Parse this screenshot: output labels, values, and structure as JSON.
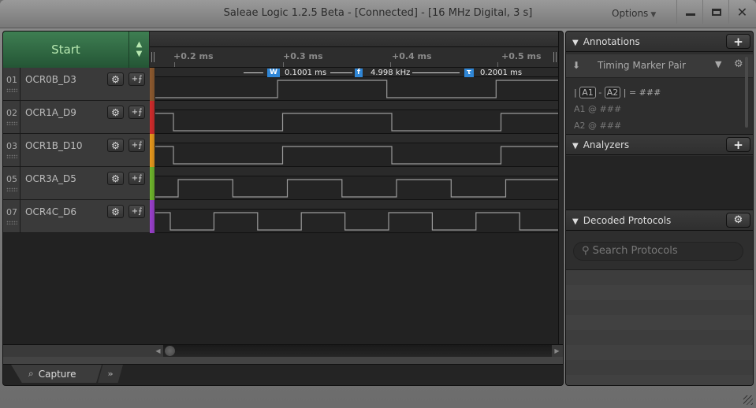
{
  "window": {
    "title": "Saleae Logic 1.2.5 Beta - [Connected] - [16 MHz Digital, 3 s]",
    "options_label": "Options",
    "controls": [
      "minimize",
      "maximize",
      "close"
    ]
  },
  "capture": {
    "start_label": "Start",
    "up_glyph": "▲",
    "down_glyph": "▼"
  },
  "ruler": {
    "ticks": [
      "+0.2 ms",
      "+0.3 ms",
      "+0.4 ms",
      "+0.5 ms"
    ]
  },
  "measurement": {
    "width_badge": "W",
    "width_value": "0.1001 ms",
    "freq_badge": "f",
    "freq_value": "4.998 kHz",
    "period_badge": "τ",
    "period_value": "0.2001 ms"
  },
  "channels": [
    {
      "num": "01",
      "name": "OCR0B_D3",
      "color": "#8f5a2e",
      "period_ms": 0.2001,
      "duty": 0.5
    },
    {
      "num": "02",
      "name": "OCR1A_D9",
      "color": "#d42a2a",
      "period_ms": 0.2,
      "duty": 0.5
    },
    {
      "num": "03",
      "name": "OCR1B_D10",
      "color": "#eb9a1a",
      "period_ms": 0.2,
      "duty": 0.5
    },
    {
      "num": "05",
      "name": "OCR3A_D5",
      "color": "#6fb82a",
      "period_ms": 0.1,
      "duty": 0.5
    },
    {
      "num": "07",
      "name": "OCR4C_D6",
      "color": "#9c3fd0",
      "period_ms": 0.08,
      "duty": 0.5
    }
  ],
  "tabs": {
    "capture_label": "Capture",
    "more_glyph": "»"
  },
  "side": {
    "annotations": {
      "title": "Annotations",
      "add_glyph": "+",
      "marker_label": "Timing Marker Pair",
      "line1_a": "A1",
      "line1_b": "A2",
      "line1_eq": "= ###",
      "line2": "A1  @  ###",
      "line3": "A2  @  ###"
    },
    "analyzers": {
      "title": "Analyzers",
      "add_glyph": "+"
    },
    "decoded": {
      "title": "Decoded Protocols",
      "search_placeholder": "Search Protocols"
    }
  }
}
